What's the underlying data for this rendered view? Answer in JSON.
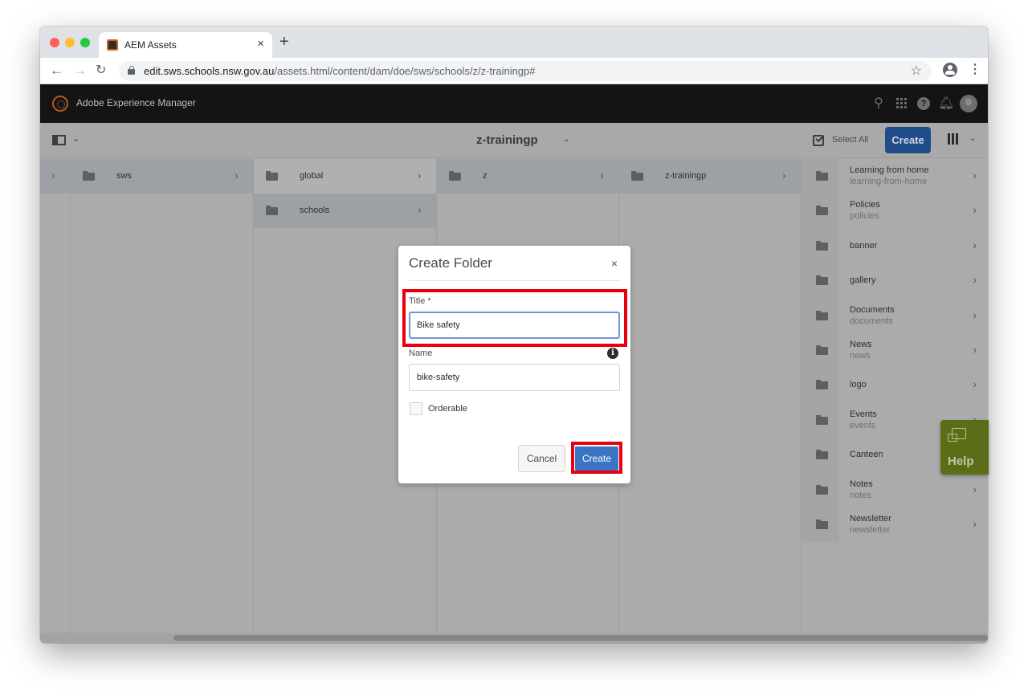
{
  "browser": {
    "tab_title": "AEM Assets",
    "new_tab_label": "+",
    "url_domain": "edit.sws.schools.nsw.gov.au",
    "url_path": "/assets.html/content/dam/doe/sws/schools/z/z-trainingp#"
  },
  "shell": {
    "title": "Adobe Experience Manager",
    "icons": [
      "search-icon",
      "solutions-grid-icon",
      "help-icon",
      "notifications-bell-icon",
      "user-avatar-icon"
    ]
  },
  "actionbar": {
    "title": "z-trainingp",
    "select_all_label": "Select All",
    "create_label": "Create"
  },
  "columns": [
    {
      "items": [
        {
          "name": "sws",
          "active": true
        }
      ]
    },
    {
      "items": [
        {
          "name": "global",
          "active": false
        },
        {
          "name": "schools",
          "active": true
        }
      ]
    },
    {
      "items": [
        {
          "name": "z",
          "active": true
        }
      ]
    },
    {
      "items": [
        {
          "name": "z-trainingp",
          "active": true
        }
      ]
    }
  ],
  "folder_list": [
    {
      "title": "Learning from home",
      "name": "learning-from-home"
    },
    {
      "title": "Policies",
      "name": "policies"
    },
    {
      "title": "banner",
      "name": ""
    },
    {
      "title": "gallery",
      "name": ""
    },
    {
      "title": "Documents",
      "name": "documents"
    },
    {
      "title": "News",
      "name": "news"
    },
    {
      "title": "logo",
      "name": ""
    },
    {
      "title": "Events",
      "name": "events"
    },
    {
      "title": "Canteen",
      "name": ""
    },
    {
      "title": "Notes",
      "name": "notes"
    },
    {
      "title": "Newsletter",
      "name": "newsletter"
    }
  ],
  "help_widget": {
    "label": "Help"
  },
  "dialog": {
    "title": "Create Folder",
    "close_label": "×",
    "title_field_label": "Title *",
    "title_field_value": "Bike safety",
    "name_field_label": "Name",
    "name_field_value": "bike-safety",
    "orderable_label": "Orderable",
    "orderable_checked": false,
    "cancel_label": "Cancel",
    "create_label": "Create"
  },
  "colors": {
    "create_button": "#3b74c4",
    "highlight": "#e8000d",
    "help_widget": "#5b6e17"
  }
}
